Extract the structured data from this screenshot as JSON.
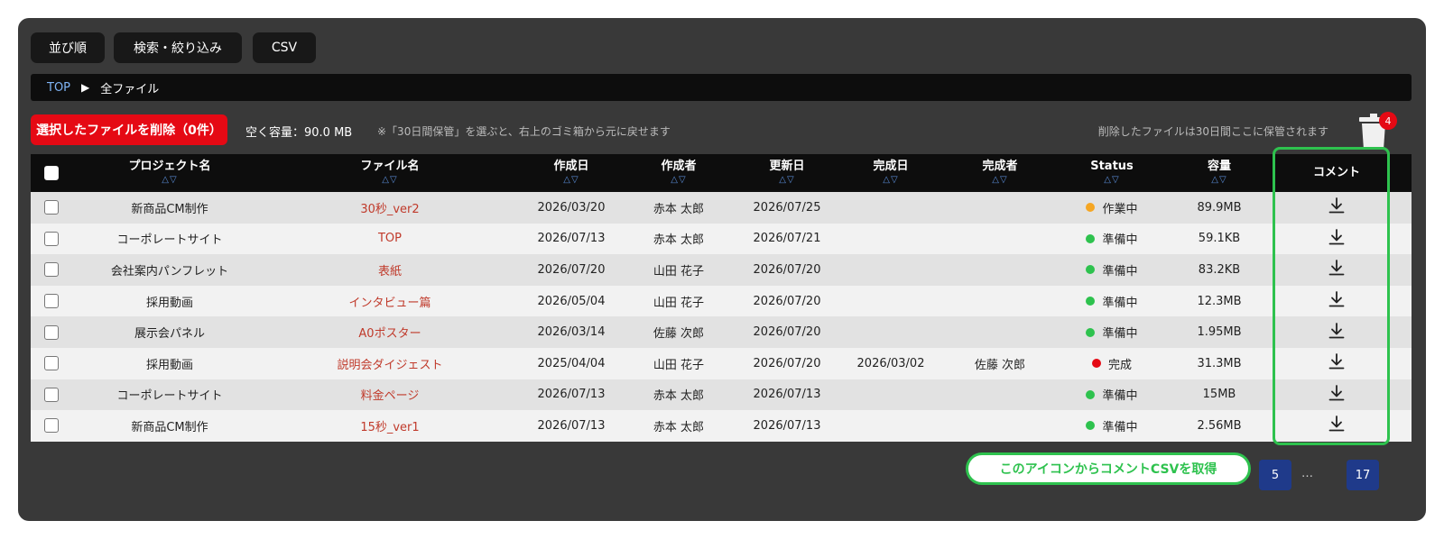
{
  "toolbar": {
    "sort_label": "並び順",
    "filter_label": "検索・絞り込み",
    "csv_label": "CSV"
  },
  "breadcrumb": {
    "top": "TOP",
    "current": "全ファイル"
  },
  "actions": {
    "delete_label": "選択したファイルを削除（0件）",
    "free_space": "空く容量：90.0 MB",
    "note": "※「30日間保管」を選ぶと、右上のゴミ箱から元に戻せます",
    "keep_note": "削除したファイルは30日間ここに保管されます",
    "trash_count": "4",
    "trash_icon": "trash-icon"
  },
  "table": {
    "sort_glyph": "△▽",
    "headers": {
      "project": "プロジェクト名",
      "file": "ファイル名",
      "created": "作成日",
      "author": "作成者",
      "updated": "更新日",
      "completed": "完成日",
      "completer": "完成者",
      "status": "Status",
      "size": "容量",
      "comment": "コメント"
    },
    "rows": [
      {
        "project": "新商品CM制作",
        "file": "30秒_ver2",
        "created": "2026/03/20",
        "author": "赤本 太郎",
        "updated": "2026/07/25",
        "completed": "",
        "completer": "",
        "status": "作業中",
        "status_color": "#f5a623",
        "size": "89.9MB"
      },
      {
        "project": "コーポレートサイト",
        "file": "TOP",
        "created": "2026/07/13",
        "author": "赤本 太郎",
        "updated": "2026/07/21",
        "completed": "",
        "completer": "",
        "status": "準備中",
        "status_color": "#2ec24e",
        "size": "59.1KB"
      },
      {
        "project": "会社案内パンフレット",
        "file": "表紙",
        "created": "2026/07/20",
        "author": "山田 花子",
        "updated": "2026/07/20",
        "completed": "",
        "completer": "",
        "status": "準備中",
        "status_color": "#2ec24e",
        "size": "83.2KB"
      },
      {
        "project": "採用動画",
        "file": "インタビュー篇",
        "created": "2026/05/04",
        "author": "山田 花子",
        "updated": "2026/07/20",
        "completed": "",
        "completer": "",
        "status": "準備中",
        "status_color": "#2ec24e",
        "size": "12.3MB"
      },
      {
        "project": "展示会パネル",
        "file": "A0ポスター",
        "created": "2026/03/14",
        "author": "佐藤 次郎",
        "updated": "2026/07/20",
        "completed": "",
        "completer": "",
        "status": "準備中",
        "status_color": "#2ec24e",
        "size": "1.95MB"
      },
      {
        "project": "採用動画",
        "file": "説明会ダイジェスト",
        "created": "2025/04/04",
        "author": "山田 花子",
        "updated": "2026/07/20",
        "completed": "2026/03/02",
        "completer": "佐藤 次郎",
        "status": "完成",
        "status_color": "#e50914",
        "size": "31.3MB"
      },
      {
        "project": "コーポレートサイト",
        "file": "料金ページ",
        "created": "2026/07/13",
        "author": "赤本 太郎",
        "updated": "2026/07/13",
        "completed": "",
        "completer": "",
        "status": "準備中",
        "status_color": "#2ec24e",
        "size": "15MB"
      },
      {
        "project": "新商品CM制作",
        "file": "15秒_ver1",
        "created": "2026/07/13",
        "author": "赤本 太郎",
        "updated": "2026/07/13",
        "completed": "",
        "completer": "",
        "status": "準備中",
        "status_color": "#2ec24e",
        "size": "2.56MB"
      }
    ],
    "download_icon": "download-icon"
  },
  "pagination": {
    "page_5": "5",
    "ellipsis": "…",
    "last": "17"
  },
  "callout": "このアイコンからコメントCSVを取得",
  "colors": {
    "panel": "#393939",
    "delete": "#e50914",
    "highlight": "#2ec24e",
    "page": "#1f3a8a",
    "file_link": "#c03a2b"
  }
}
